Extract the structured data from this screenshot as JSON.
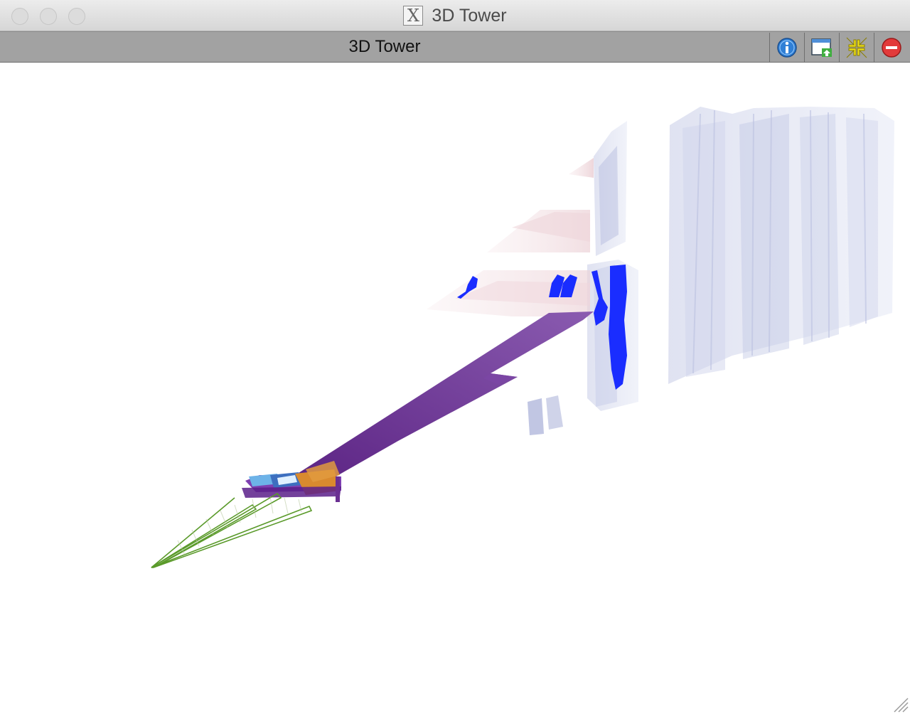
{
  "window": {
    "title": "3D Tower"
  },
  "toolbar": {
    "title": "3D Tower",
    "buttons": [
      {
        "name": "info",
        "icon": "info-icon"
      },
      {
        "name": "export",
        "icon": "window-export-icon"
      },
      {
        "name": "fit",
        "icon": "fit-view-icon"
      },
      {
        "name": "close",
        "icon": "close-icon"
      }
    ]
  },
  "scene": {
    "colors": {
      "track": "#6a2f92",
      "calorimeter_orange": "#d98a2e",
      "vertex_green": "#5a9a2a",
      "hits": "#1a2dff",
      "detector_glass": "#c8cde8",
      "shelf_pink": "#f0d8dc"
    }
  }
}
